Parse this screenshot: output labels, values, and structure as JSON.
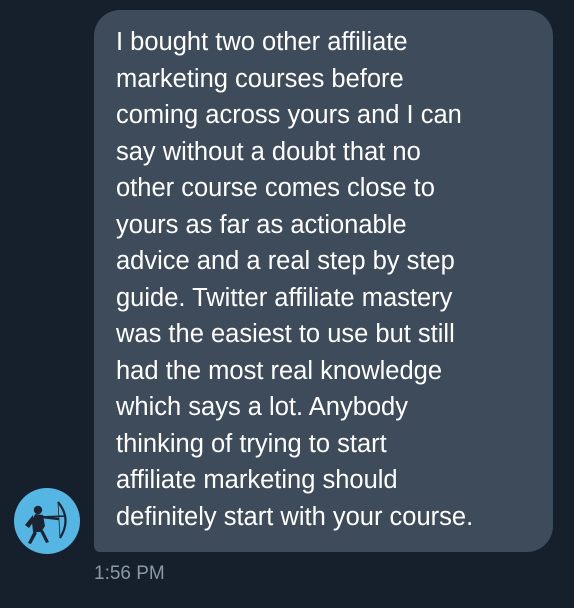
{
  "conversation": {
    "message": {
      "lines": [
        "I bought two other affiliate",
        "marketing courses before",
        "coming across yours and I can",
        "say without a doubt that no",
        "other course comes close to",
        "yours as far as actionable",
        "advice and a real step by step",
        "guide. Twitter affiliate mastery",
        "was the easiest to use but still",
        "had the most real knowledge",
        "which says a lot. Anybody",
        "thinking of trying to start",
        "affiliate marketing should",
        "definitely start with your course."
      ],
      "timestamp": "1:56 PM"
    },
    "sender": {
      "avatar_icon": "archer-avatar-icon"
    }
  },
  "colors": {
    "background": "#16202c",
    "bubble": "#3e4b5a",
    "text": "#ffffff",
    "timestamp": "#8b98a5",
    "avatar_bg": "#56b6e3"
  }
}
